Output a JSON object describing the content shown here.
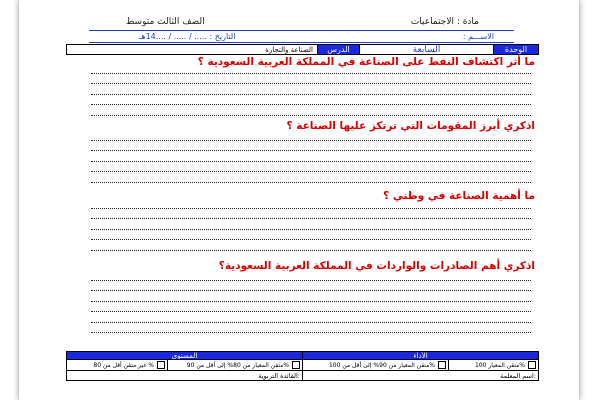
{
  "header": {
    "subject": "مادة : الاجتماعيات",
    "grade": "الصف الثالث متوسط",
    "name": "الاســـم :",
    "date": "التاريخ : ..... / ..... / ....14هـ"
  },
  "info_table": {
    "unit_label": "الوحدة",
    "unit_value": "السابعة",
    "lesson_label": "الدرس",
    "lesson_value": "الصناعة والتجارة"
  },
  "questions": [
    "ما أثر اكتشاف النفط على الصناعة  في المملكة العربية السعودية ؟",
    "اذكري أبرز المقومات التي ترتكز عليها الصناعة ؟",
    "ما أهمية الصناعة في وطني ؟",
    "اذكري أهم الصادرات والواردات في المملكة العربية السعودية؟"
  ],
  "footer": {
    "label_right": "الأداء",
    "label_left": "المستوى",
    "levels": [
      "متقن المعيار 100%",
      "متقن المعيار من 90% إلى أقل من 100%",
      "متقن المعيار من 80% إلى أقل من 90%",
      "غير متقن أقل من 80 %"
    ],
    "teacher": "اسم المعلمة:",
    "leader": "القائدة التربوية:"
  },
  "colors": {
    "question": "#d90000",
    "header_blue": "#1f3fbf",
    "cell_blue": "#1a28e0"
  }
}
